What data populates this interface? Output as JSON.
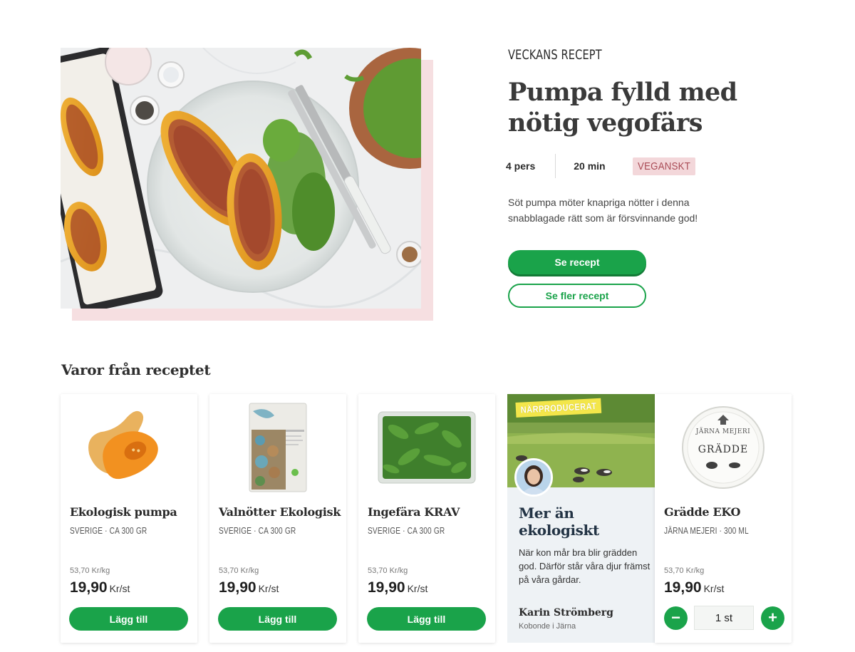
{
  "hero": {
    "kicker": "VECKANS RECEPT",
    "title": "Pumpa fylld med nötig vegofärs",
    "servings": "4 pers",
    "time": "20 min",
    "diet_tag": "VEGANSKT",
    "description": "Söt pumpa möter knapriga nötter i denna snabblagade rätt som är försvinnande god!",
    "primary_button": "Se recept",
    "secondary_button": "Se fler recept"
  },
  "products_section": {
    "title": "Varor från receptet",
    "items": [
      {
        "name": "Ekologisk pumpa",
        "origin": "SVERIGE · CA 300 GR",
        "unit_price": "53,70 Kr/kg",
        "price": "19,90",
        "price_unit": "Kr/st",
        "button": "Lägg till"
      },
      {
        "name": "Valnötter Ekologisk",
        "origin": "SVERIGE · CA 300 GR",
        "unit_price": "53,70 Kr/kg",
        "price": "19,90",
        "price_unit": "Kr/st",
        "button": "Lägg till"
      },
      {
        "name": "Ingefära KRAV",
        "origin": "SVERIGE · CA 300 GR",
        "unit_price": "53,70 Kr/kg",
        "price": "19,90",
        "price_unit": "Kr/st",
        "button": "Lägg till"
      }
    ],
    "promo": {
      "badge": "NÄRPRODUCERAT",
      "title": "Mer än ekologiskt",
      "text": "När kon mår bra blir grädden god. Därför står våra djur främst på våra gårdar.",
      "person_name": "Karin Strömberg",
      "person_location": "Kobonde i Järna"
    },
    "featured": {
      "name": "Grädde EKO",
      "origin": "JÄRNA MEJERI · 300 ML",
      "unit_price": "53,70 Kr/kg",
      "price": "19,90",
      "price_unit": "Kr/st",
      "quantity": "1 st",
      "minus": "−",
      "plus": "+",
      "package_brand": "JÄRNA MEJERI",
      "package_label": "GRÄDDE"
    }
  },
  "colors": {
    "brand_green": "#1aa34a",
    "diet_tag_bg": "#f3d7da",
    "hero_shadow": "#f6dfe1"
  }
}
